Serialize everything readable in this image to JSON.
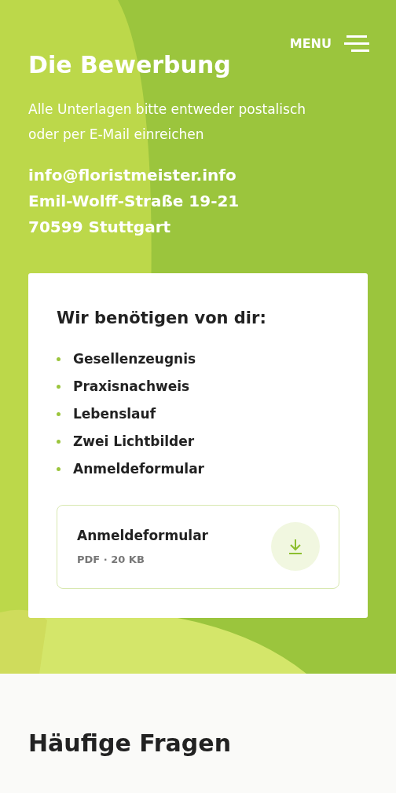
{
  "header": {
    "title": "Die Bewerbung",
    "menu_label": "MENU"
  },
  "intro": "Alle Unterlagen bitte entweder postalisch oder per E-Mail einreichen",
  "contact": {
    "email": "info@floristmeister.info",
    "street": "Emil-Wolff-Straße 19-21",
    "city": "70599 Stuttgart"
  },
  "card": {
    "heading": "Wir benötigen von dir:",
    "items": [
      "Gesellenzeugnis",
      "Praxisnachweis",
      "Lebenslauf",
      "Zwei Lichtbilder",
      "Anmeldeformular"
    ],
    "download": {
      "name": "Anmeldeformular",
      "meta": "PDF · 20 KB"
    }
  },
  "faq": {
    "heading": "Häufige Fragen"
  }
}
